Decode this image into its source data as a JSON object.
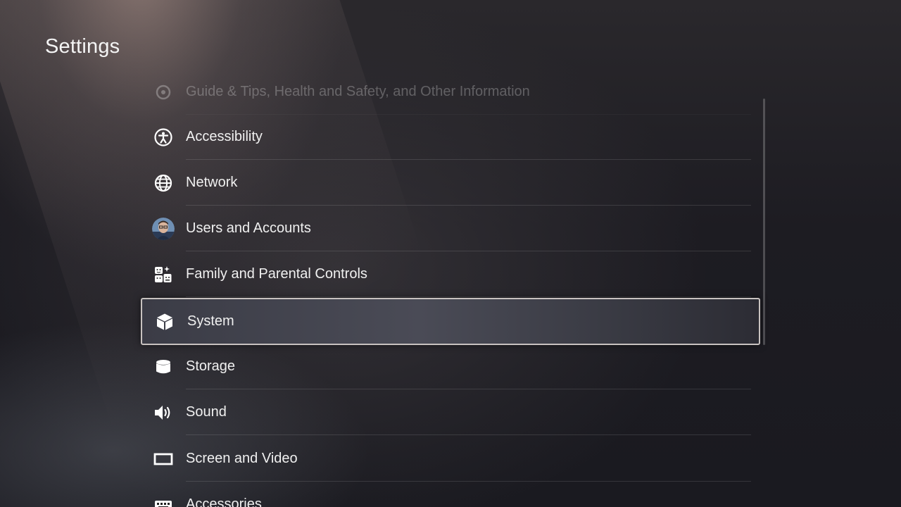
{
  "page": {
    "title": "Settings"
  },
  "menu": {
    "items": [
      {
        "label": "Guide & Tips, Health and Safety, and Other Information",
        "icon": "guide-icon"
      },
      {
        "label": "Accessibility",
        "icon": "accessibility-icon"
      },
      {
        "label": "Network",
        "icon": "globe-icon"
      },
      {
        "label": "Users and Accounts",
        "icon": "user-avatar-icon"
      },
      {
        "label": "Family and Parental Controls",
        "icon": "family-icon"
      },
      {
        "label": "System",
        "icon": "cube-icon"
      },
      {
        "label": "Storage",
        "icon": "storage-icon"
      },
      {
        "label": "Sound",
        "icon": "speaker-icon"
      },
      {
        "label": "Screen and Video",
        "icon": "screen-icon"
      },
      {
        "label": "Accessories",
        "icon": "keyboard-icon"
      }
    ],
    "selected": "System"
  },
  "colors": {
    "selection_border": "#c8c2c0",
    "background": "#1c1c22",
    "text": "#f0f0f0"
  }
}
